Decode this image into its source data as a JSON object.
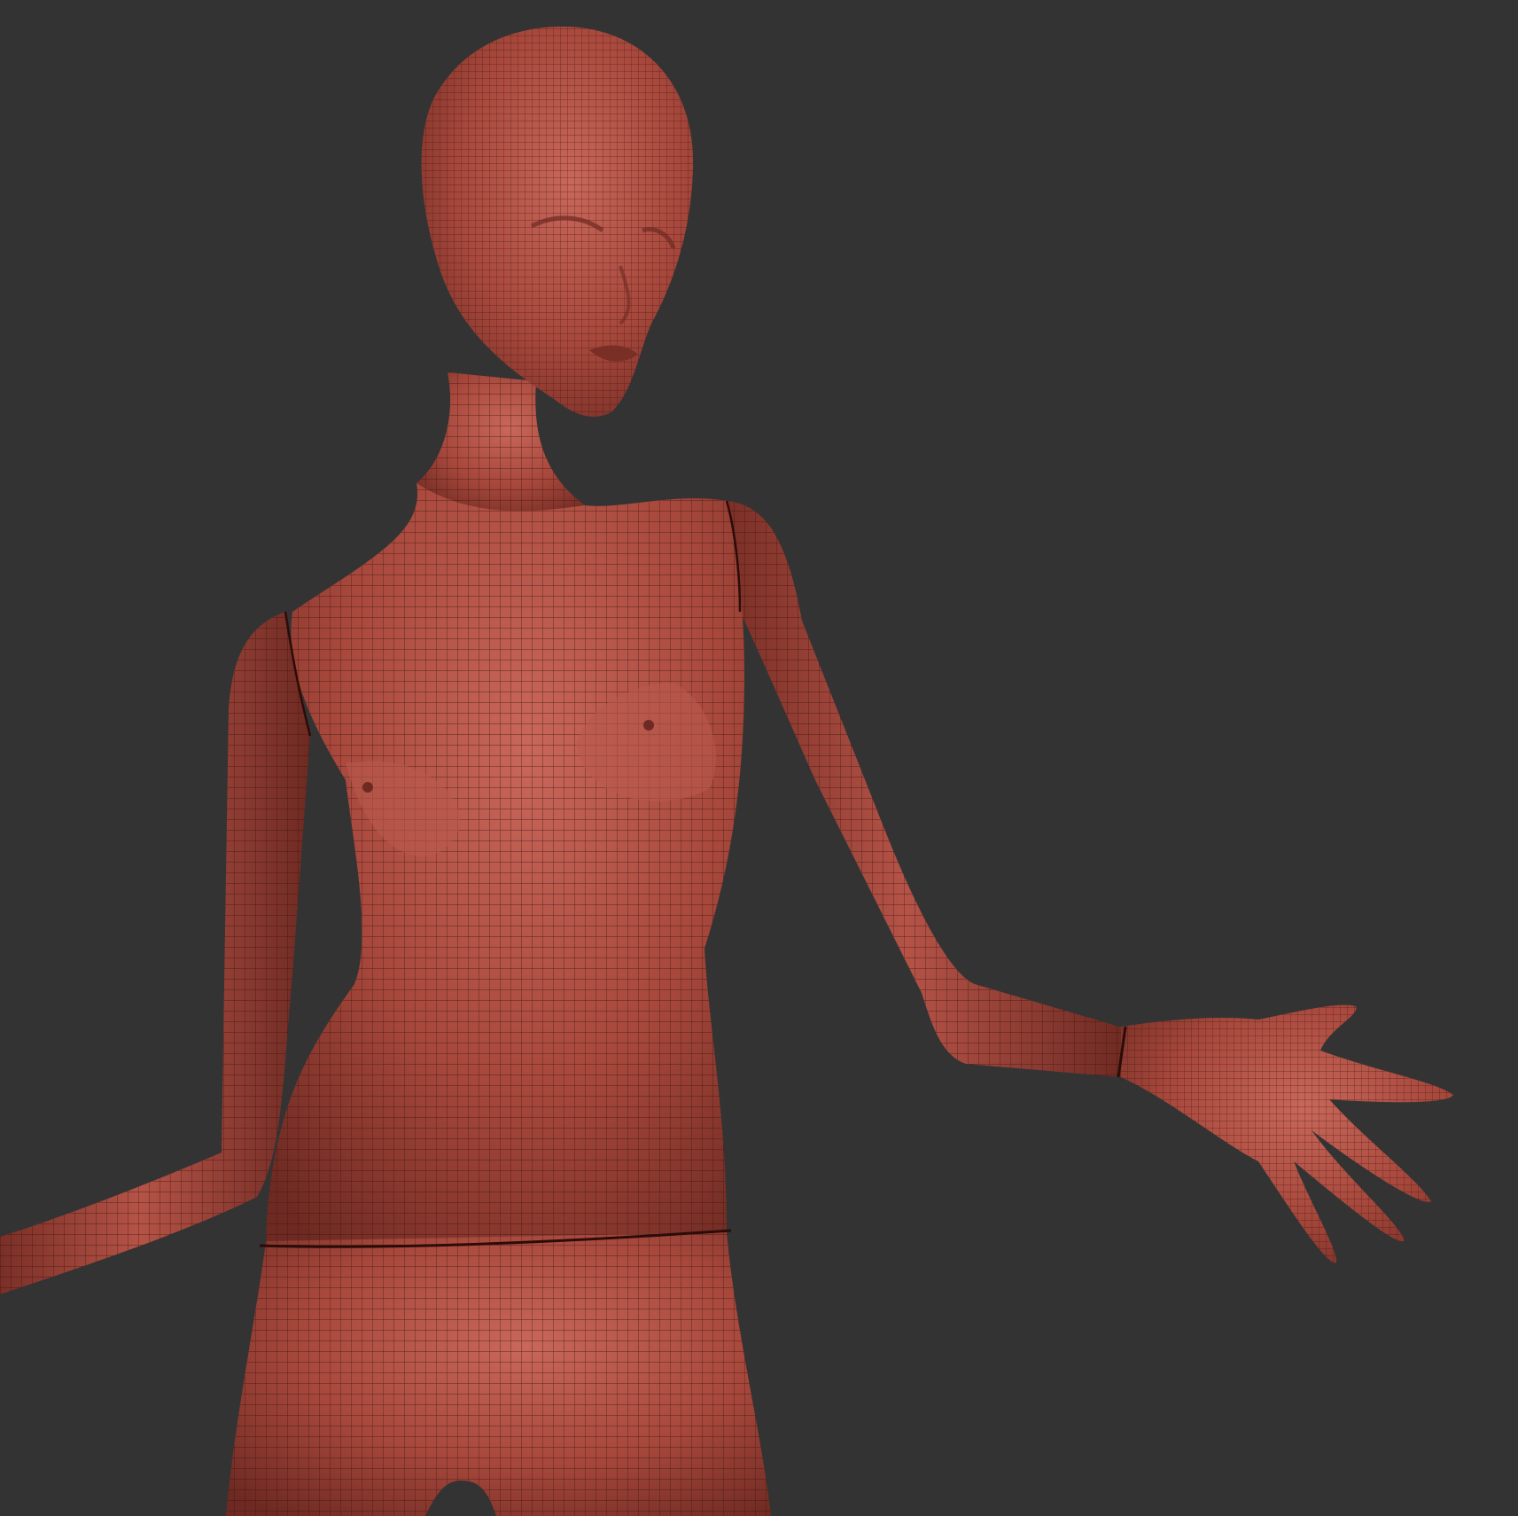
{
  "viewport": {
    "background_color": "#333333"
  },
  "model": {
    "subject": "female-mannequin-wireframe",
    "base_color": "#a8483c",
    "highlight_color": "#c8675a",
    "shadow_color": "#6e2a22",
    "wire_color": "#3a120e",
    "parts": [
      "head",
      "neck",
      "torso",
      "right-arm",
      "left-arm",
      "left-hand",
      "pelvis"
    ]
  }
}
